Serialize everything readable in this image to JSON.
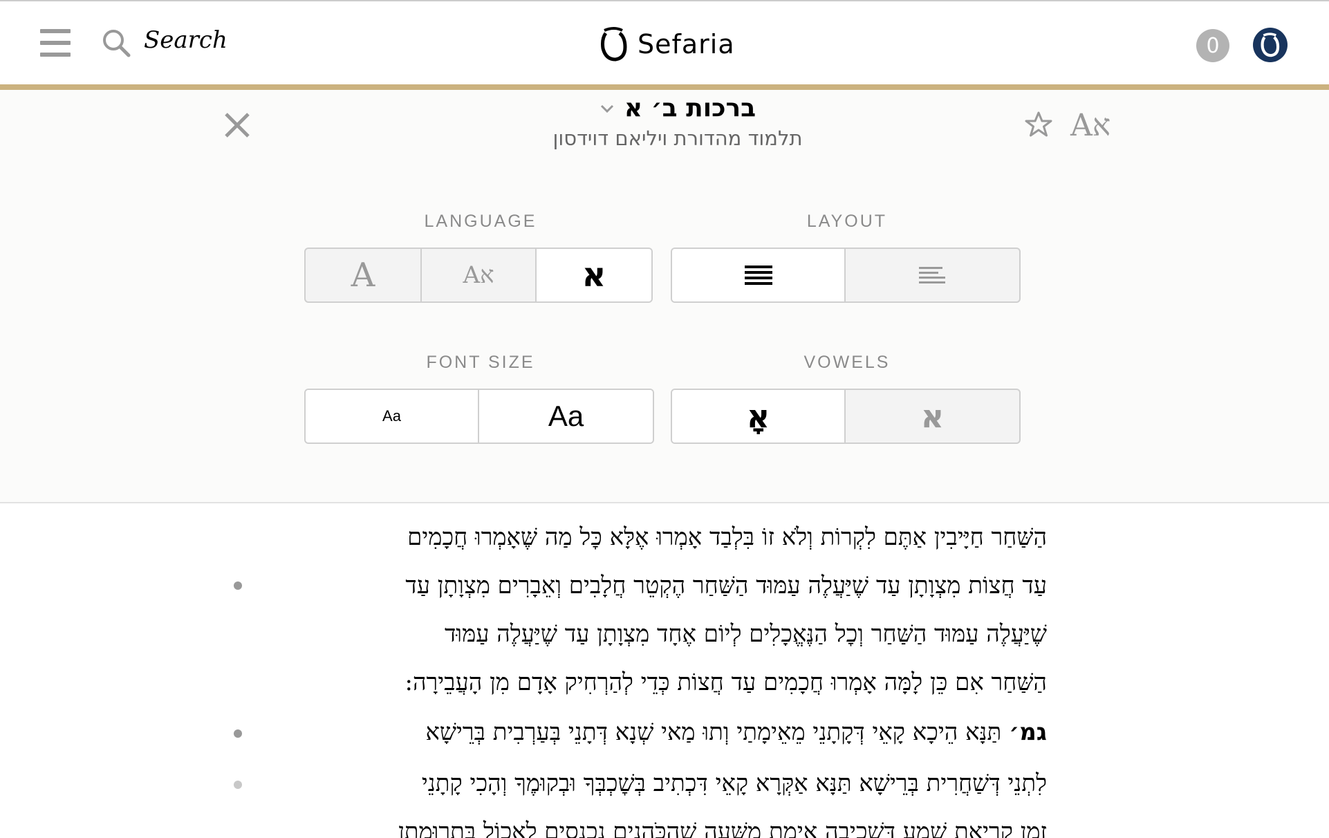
{
  "header": {
    "search_label": "Search",
    "logo_text": "Sefaria",
    "notifications_count": "0"
  },
  "panel": {
    "title": "ברכות ב׳ א",
    "subtitle": "תלמוד מהדורת ויליאם דוידסון",
    "lang_toggle": "Aא",
    "sections": {
      "language": {
        "label": "LANGUAGE",
        "options": [
          "A",
          "Aא",
          "א"
        ],
        "selected": 2
      },
      "layout": {
        "label": "LAYOUT",
        "options": [
          "continuous-icon",
          "segmented-icon"
        ],
        "selected": 0
      },
      "font_size": {
        "label": "FONT SIZE",
        "options": [
          "Aa",
          "Aa"
        ]
      },
      "vowels": {
        "label": "VOWELS",
        "options": [
          "אָ",
          "א"
        ],
        "selected": 0
      }
    }
  },
  "reader": {
    "lines": [
      "הַשַּׁחַר חַיָּיבִין אַתֶּם לִקְרוֹת וְלֹא זוֹ בִּלְבַד אָמְרוּ אֶלָּא כׇּל מַה שֶּׁאָמְרוּ חֲכָמִים",
      "עַד חֲצוֹת מִצְוָתָן עַד שֶׁיַּעֲלֶה עַמּוּד הַשַּׁחַר הֶקְטֵר חֲלָבִים וְאֵבָרִים מִצְוָתָן עַד",
      "שֶׁיַּעֲלֶה עַמּוּד הַשַּׁחַר וְכׇל הַנֶּאֱכָלִים לְיוֹם אֶחָד מִצְוָתָן עַד שֶׁיַּעֲלֶה עַמּוּד",
      "הַשַּׁחַר אִם כֵּן לָמָּה אָמְרוּ חֲכָמִים עַד חֲצוֹת כְּדֵי לְהַרְחִיק אָדָם מִן הָעֲבֵירָה:",
      "תַּנָּא הֵיכָא קָאֵי דְּקָתָנֵי מֵאֵימָתַי וְתוּ מַאי שְׁנָא דְּתָנֵי בְּעַרְבִית בְּרֵישָׁא",
      "לִתְנֵי דְּשַׁחֲרִית בְּרֵישָׁא תַּנָּא אַקְּרָא קָאֵי דִּכְתִיב בְּשׇׁכְבְּךָ וּבְקוּמֶךָ וְהָכִי קָתָנֵי",
      "זְמַן קְרִיאַת שְׁמַע דִּשְׁכִיבָה אֵימַת מִשָּׁעָה שֶׁהַכֹּהֲנִים נִכְנָסִים לֶאֱכוֹל בִּתְרוּמָתָן"
    ],
    "gmara_marker": "גמ׳"
  }
}
